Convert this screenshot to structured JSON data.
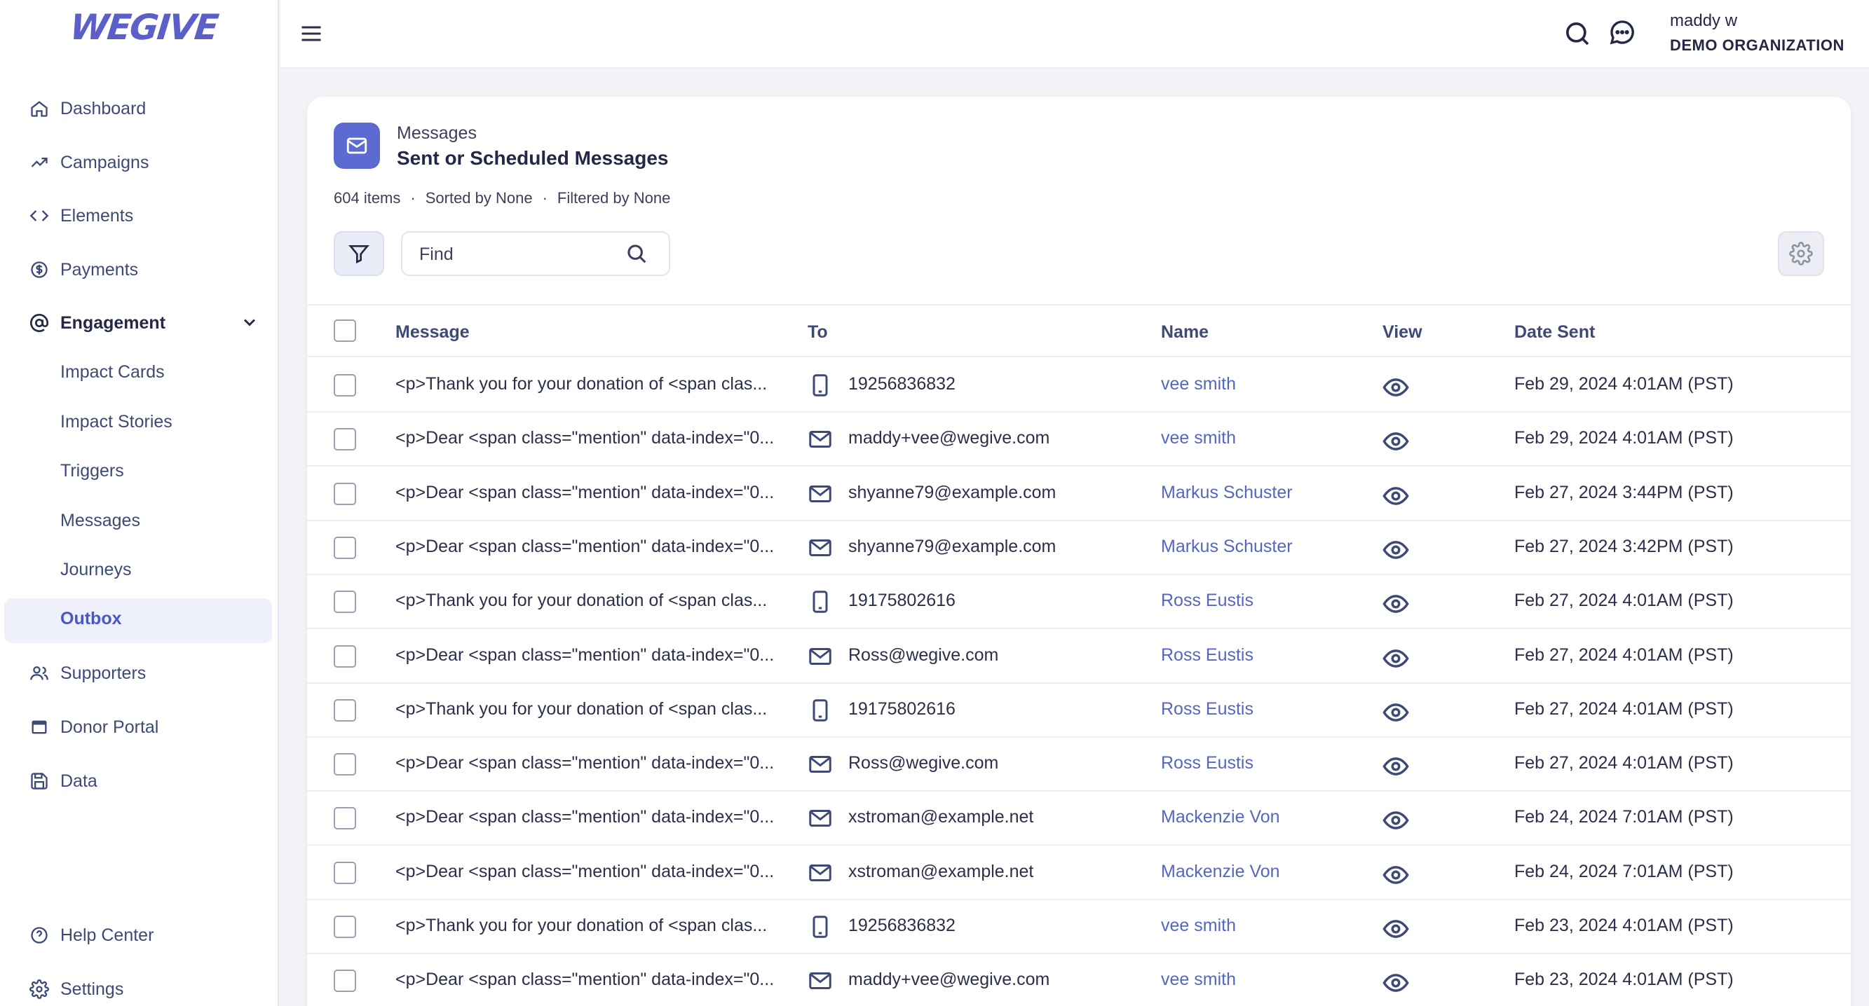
{
  "app": {
    "logo_text": "WEGIVE"
  },
  "sidebar": {
    "items": [
      {
        "label": "Dashboard",
        "icon": "home-icon"
      },
      {
        "label": "Campaigns",
        "icon": "trending-up-icon"
      },
      {
        "label": "Elements",
        "icon": "code-icon"
      },
      {
        "label": "Payments",
        "icon": "dollar-circle-icon"
      },
      {
        "label": "Engagement",
        "icon": "at-sign-icon"
      },
      {
        "label": "Supporters",
        "icon": "users-icon"
      },
      {
        "label": "Donor Portal",
        "icon": "portal-icon"
      },
      {
        "label": "Data",
        "icon": "save-icon"
      }
    ],
    "engagement_sub": [
      "Impact Cards",
      "Impact Stories",
      "Triggers",
      "Messages",
      "Journeys",
      "Outbox"
    ],
    "active_sub": "Outbox",
    "bottom": [
      {
        "label": "Help Center",
        "icon": "help-icon"
      },
      {
        "label": "Settings",
        "icon": "gear-icon"
      }
    ]
  },
  "topbar": {
    "user_name": "maddy w",
    "org_name": "DEMO ORGANIZATION"
  },
  "page": {
    "eyebrow": "Messages",
    "title": "Sent or Scheduled Messages",
    "items_count": "604 items",
    "sorted_by": "Sorted by None",
    "filtered_by": "Filtered by None",
    "search_placeholder": "Find"
  },
  "table": {
    "columns": [
      "Message",
      "To",
      "Name",
      "View",
      "Date Sent"
    ],
    "rows": [
      {
        "message": "<p>Thank you for your donation of <span clas...",
        "to_type": "phone",
        "to": "19256836832",
        "name": "vee smith",
        "date": "Feb 29, 2024 4:01AM (PST)"
      },
      {
        "message": "<p>Dear <span class=\"mention\" data-index=\"0...",
        "to_type": "email",
        "to": "maddy+vee@wegive.com",
        "name": "vee smith",
        "date": "Feb 29, 2024 4:01AM (PST)"
      },
      {
        "message": "<p>Dear <span class=\"mention\" data-index=\"0...",
        "to_type": "email",
        "to": "shyanne79@example.com",
        "name": "Markus Schuster",
        "date": "Feb 27, 2024 3:44PM (PST)"
      },
      {
        "message": "<p>Dear <span class=\"mention\" data-index=\"0...",
        "to_type": "email",
        "to": "shyanne79@example.com",
        "name": "Markus Schuster",
        "date": "Feb 27, 2024 3:42PM (PST)"
      },
      {
        "message": "<p>Thank you for your donation of <span clas...",
        "to_type": "phone",
        "to": "19175802616",
        "name": "Ross Eustis",
        "date": "Feb 27, 2024 4:01AM (PST)"
      },
      {
        "message": "<p>Dear <span class=\"mention\" data-index=\"0...",
        "to_type": "email",
        "to": "Ross@wegive.com",
        "name": "Ross Eustis",
        "date": "Feb 27, 2024 4:01AM (PST)"
      },
      {
        "message": "<p>Thank you for your donation of <span clas...",
        "to_type": "phone",
        "to": "19175802616",
        "name": "Ross Eustis",
        "date": "Feb 27, 2024 4:01AM (PST)"
      },
      {
        "message": "<p>Dear <span class=\"mention\" data-index=\"0...",
        "to_type": "email",
        "to": "Ross@wegive.com",
        "name": "Ross Eustis",
        "date": "Feb 27, 2024 4:01AM (PST)"
      },
      {
        "message": "<p>Dear <span class=\"mention\" data-index=\"0...",
        "to_type": "email",
        "to": "xstroman@example.net",
        "name": "Mackenzie Von",
        "date": "Feb 24, 2024 7:01AM (PST)"
      },
      {
        "message": "<p>Dear <span class=\"mention\" data-index=\"0...",
        "to_type": "email",
        "to": "xstroman@example.net",
        "name": "Mackenzie Von",
        "date": "Feb 24, 2024 7:01AM (PST)"
      },
      {
        "message": "<p>Thank you for your donation of <span clas...",
        "to_type": "phone",
        "to": "19256836832",
        "name": "vee smith",
        "date": "Feb 23, 2024 4:01AM (PST)"
      },
      {
        "message": "<p>Dear <span class=\"mention\" data-index=\"0...",
        "to_type": "email",
        "to": "maddy+vee@wegive.com",
        "name": "vee smith",
        "date": "Feb 23, 2024 4:01AM (PST)"
      }
    ]
  },
  "colors": {
    "accent": "#5d6ad1",
    "link": "#5566c0",
    "nav_text": "#3d4a76"
  }
}
